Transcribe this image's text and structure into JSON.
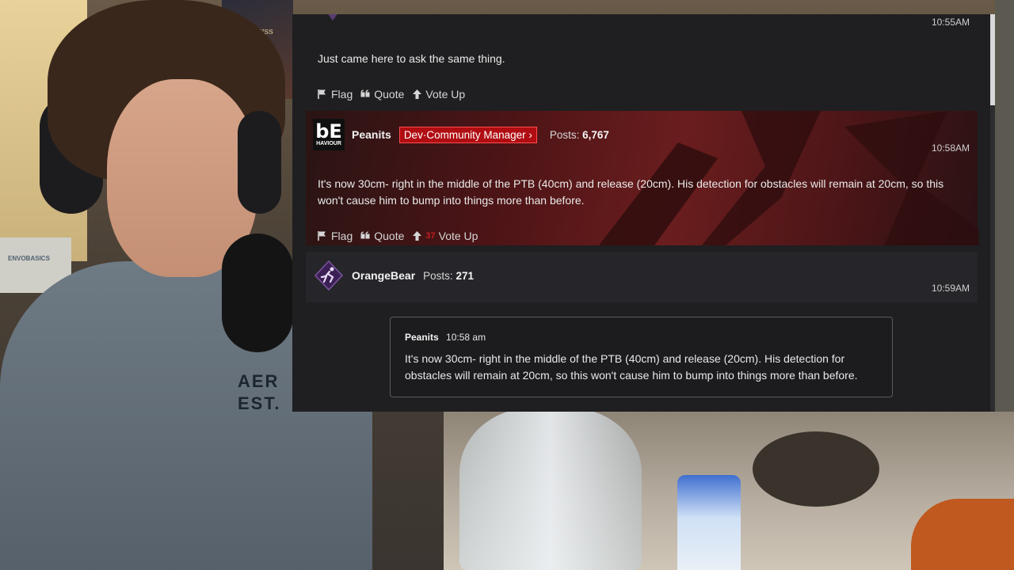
{
  "background": {
    "poster_caption": "The Abyss\nWalker",
    "shelf_label": "ENVOBASICS",
    "hoodie_print": "AER\nEST."
  },
  "colors": {
    "forum_bg": "#1f1f21",
    "staff_badge_bg": "#b00d12",
    "staff_post_bg": "#4d1416",
    "vote_count": "#c01c1c"
  },
  "posts": [
    {
      "time": "10:55AM",
      "body": "Just came here to ask the same thing.",
      "actions": {
        "flag": "Flag",
        "quote": "Quote",
        "vote": "Vote Up"
      }
    },
    {
      "author": "Peanits",
      "avatar_text": "bE",
      "avatar_sub": "HAVIOUR",
      "role_badge": "Dev·Community Manager ›",
      "posts_label": "Posts:",
      "posts_count": "6,767",
      "time": "10:58AM",
      "body": "It's now 30cm- right in the middle of the PTB (40cm) and release (20cm). His detection for obstacles will remain at 20cm, so this won't cause him to bump into things more than before.",
      "actions": {
        "flag": "Flag",
        "quote": "Quote",
        "vote_count": "37",
        "vote": "Vote Up"
      }
    },
    {
      "author": "OrangeBear",
      "avatar_icon": "running-figure-icon",
      "posts_label": "Posts:",
      "posts_count": "271",
      "time": "10:59AM",
      "quote": {
        "author": "Peanits",
        "time": "10:58 am",
        "body": "It's now 30cm- right in the middle of the PTB (40cm) and release (20cm). His detection for obstacles will remain at 20cm, so this won't cause him to bump into things more than before."
      }
    }
  ]
}
